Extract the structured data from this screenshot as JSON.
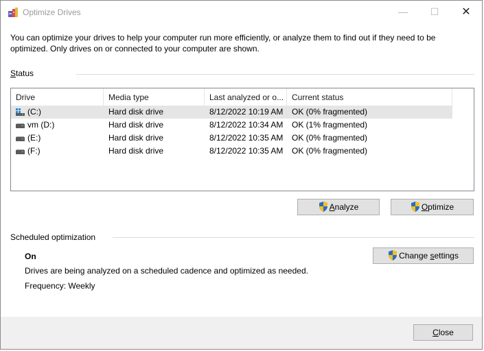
{
  "window": {
    "title": "Optimize Drives",
    "minimize_glyph": "—",
    "maximize_glyph": "☐",
    "close_glyph": "✕"
  },
  "intro_text": "You can optimize your drives to help your computer run more efficiently, or analyze them to find out if they need to be optimized. Only drives on or connected to your computer are shown.",
  "status_section": {
    "label_first": "S",
    "label_rest": "tatus"
  },
  "drive_list": {
    "columns": [
      "Drive",
      "Media type",
      "Last analyzed or o...",
      "Current status"
    ],
    "rows": [
      {
        "drive": "(C:)",
        "media_type": "Hard disk drive",
        "last_analyzed": "8/12/2022 10:19 AM",
        "status": "OK (0% fragmented)",
        "icon": "windows-drive-icon",
        "selected": true
      },
      {
        "drive": "vm (D:)",
        "media_type": "Hard disk drive",
        "last_analyzed": "8/12/2022 10:34 AM",
        "status": "OK (1% fragmented)",
        "icon": "drive-icon",
        "selected": false
      },
      {
        "drive": "(E:)",
        "media_type": "Hard disk drive",
        "last_analyzed": "8/12/2022 10:35 AM",
        "status": "OK (0% fragmented)",
        "icon": "drive-icon",
        "selected": false
      },
      {
        "drive": "(F:)",
        "media_type": "Hard disk drive",
        "last_analyzed": "8/12/2022 10:35 AM",
        "status": "OK (0% fragmented)",
        "icon": "drive-icon",
        "selected": false
      }
    ]
  },
  "buttons": {
    "analyze_first": "A",
    "analyze_rest": "nalyze",
    "optimize_first": "O",
    "optimize_rest": "ptimize",
    "change_settings_first": "Change ",
    "change_settings_u": "s",
    "change_settings_rest": "ettings",
    "close_first": "C",
    "close_rest": "lose"
  },
  "scheduled": {
    "label": "Scheduled optimization",
    "state": "On",
    "description": "Drives are being analyzed on a scheduled cadence and optimized as needed.",
    "frequency": "Frequency: Weekly"
  },
  "colors": {
    "shield_blue": "#2b6cc4",
    "shield_yellow": "#f2c21b",
    "selected_row": "#e5e5e5",
    "footer_bg": "#f0f0f0"
  }
}
